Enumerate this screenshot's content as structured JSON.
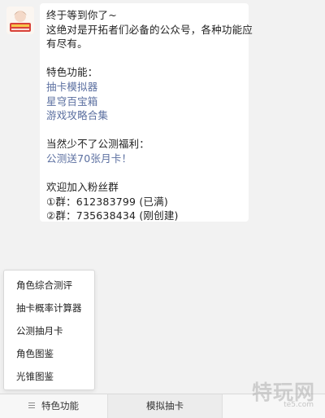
{
  "message": {
    "lines": [
      "终于等到你了~",
      "这绝对是开拓者们必备的公众号，各种功能应",
      "有尽有。"
    ],
    "features_title": "特色功能：",
    "features": [
      "抽卡模拟器",
      "星穹百宝箱",
      "游戏攻略合集"
    ],
    "welfare_title": "当然少不了公测福利：",
    "welfare_link": "公测送70张月卡！",
    "group_title": "欢迎加入粉丝群",
    "groups": [
      "①群：612383799 (已满)",
      "②群：735638434 (刚创建)"
    ]
  },
  "menu": {
    "items": [
      "角色综合测评",
      "抽卡概率计算器",
      "公测抽月卡",
      "角色图鉴",
      "光锥图鉴"
    ]
  },
  "tabbar": {
    "tabs": [
      "特色功能",
      "模拟抽卡",
      ""
    ]
  },
  "watermark": {
    "text": "特玩网",
    "sub": "te5.com"
  },
  "colors": {
    "link": "#5b6fa0",
    "background": "#f2f2f2",
    "bubble": "#ffffff"
  }
}
